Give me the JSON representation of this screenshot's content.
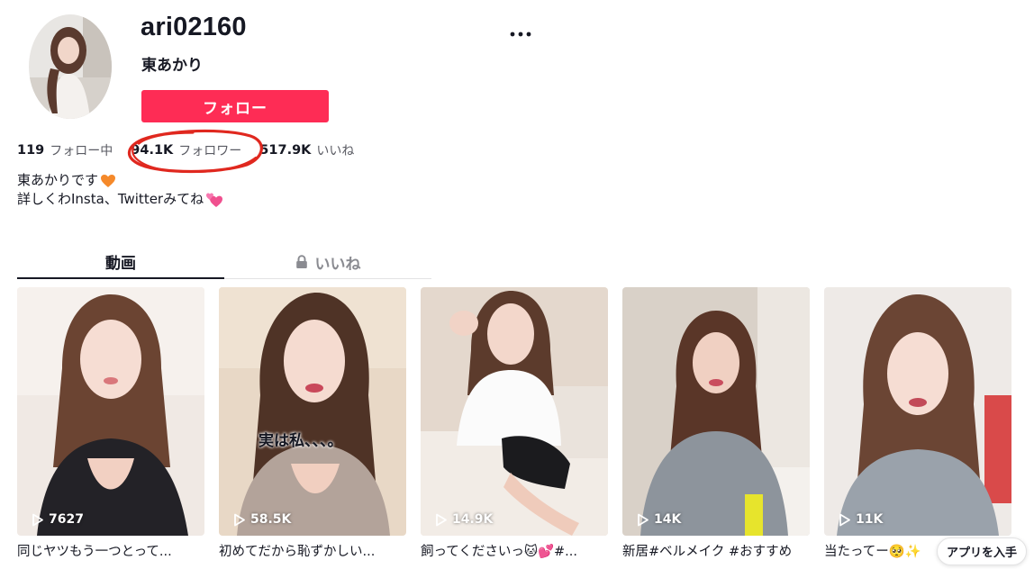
{
  "profile": {
    "username": "ari02160",
    "nickname": "東あかり",
    "follow_label": "フォロー",
    "more_icon": "more-horizontal-icon"
  },
  "stats": {
    "following_count": "119",
    "following_label": "フォロー中",
    "followers_count": "94.1K",
    "followers_label": "フォロワー",
    "likes_count": "517.9K",
    "likes_label": "いいね"
  },
  "bio": {
    "line1": "東あかりです",
    "line1_emoji": "orange-heart-icon",
    "line2": "詳しくわInsta、Twitterみてね",
    "line2_emoji": "two-hearts-icon"
  },
  "tabs": [
    {
      "label": "動画",
      "active": true
    },
    {
      "label": "いいね",
      "active": false,
      "icon": "lock-icon"
    }
  ],
  "videos": [
    {
      "views": "7627",
      "caption": "同じヤツもう一つとって...",
      "overlay": ""
    },
    {
      "views": "58.5K",
      "caption": "初めてだから恥ずかしい...",
      "overlay": "実は私、、、。"
    },
    {
      "views": "14.9K",
      "caption": "飼ってくださいっ🐱💕#...",
      "overlay": ""
    },
    {
      "views": "14K",
      "caption": "新居#ベルメイク #おすすめ",
      "overlay": ""
    },
    {
      "views": "11K",
      "caption": "当たってー🥺✨",
      "overlay": ""
    }
  ],
  "app_badge": "アプリを入手",
  "colors": {
    "accent": "#fe2c55",
    "annotation": "#e0281f",
    "text_primary": "#161823",
    "text_secondary": "#5a5b63"
  }
}
